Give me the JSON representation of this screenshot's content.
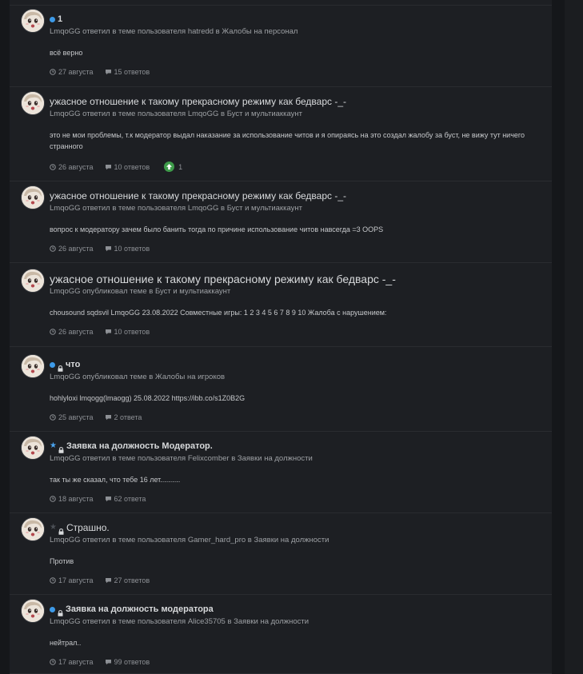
{
  "items": [
    {
      "dot": true,
      "lock": false,
      "star": null,
      "title": "1",
      "meta": "LmqoGG ответил в теме пользователя hatredd в Жалобы на персонал",
      "snippet": "всё верно",
      "date": "27 августа",
      "replies": "15 ответов"
    },
    {
      "dot": false,
      "lock": false,
      "star": null,
      "title": "ужасное отношение к такому прекрасному режиму как бедварс -_-",
      "meta": "LmqoGG ответил в теме пользователя LmqoGG в Буст и мультиаккаунт",
      "snippet": "это не мои проблемы, т.к модератор выдал наказание за использование читов и я опираясь на это создал жалобу за буст, не вижу тут ничего странного",
      "date": "26 августа",
      "replies": "10 ответов",
      "votes": "1"
    },
    {
      "dot": false,
      "lock": false,
      "star": null,
      "title": "ужасное отношение к такому прекрасному режиму как бедварс -_-",
      "meta": "LmqoGG ответил в теме пользователя LmqoGG в Буст и мультиаккаунт",
      "snippet": "вопрос к модератору зачем было банить тогда по причине использование читов навсегда =3 OOPS",
      "date": "26 августа",
      "replies": "10 ответов"
    },
    {
      "dot": false,
      "lock": false,
      "star": null,
      "title": "ужасное отношение к такому прекрасному режиму как бедварс -_-",
      "meta": "LmqoGG опубликовал теме в Буст и мультиаккаунт",
      "snippet": "chousound sqdsvil LmqoGG 23.08.2022 Совместные игры: 1 2 3 4 5 6 7 8 9 10 Жалоба с нарушением:",
      "date": "26 августа",
      "replies": "10 ответов"
    },
    {
      "dot": true,
      "lock": true,
      "star": null,
      "title": "что",
      "meta": "LmqoGG опубликовал теме в Жалобы на игроков",
      "snippet": "hohlyloxi lmqogg(lmaogg) 25.08.2022 https://ibb.co/s1Z0B2G",
      "date": "25 августа",
      "replies": "2 ответа"
    },
    {
      "dot": false,
      "lock": true,
      "star": "blue",
      "title": "Заявка на должность Модератор.",
      "meta": "LmqoGG ответил в теме пользователя Felixcomber в Заявки на должности",
      "snippet": "так ты же сказал, что тебе 16 лет..........",
      "date": "18 августа",
      "replies": "62 ответа"
    },
    {
      "dot": false,
      "lock": true,
      "star": "grey",
      "title": "Страшно.",
      "meta": "LmqoGG ответил в теме пользователя Gamer_hard_pro в Заявки на должности",
      "snippet": "Против",
      "date": "17 августа",
      "replies": "27 ответов"
    },
    {
      "dot": true,
      "lock": true,
      "star": null,
      "title": "Заявка на должность модератора",
      "meta": "LmqoGG ответил в теме пользователя Alice35705 в Заявки на должности",
      "snippet": "нейтрал..",
      "date": "17 августа",
      "replies": "99 ответов"
    }
  ],
  "colors": {
    "background": "#15171a",
    "panel": "#1d1f23",
    "unread_dot": "#3d9ae8",
    "upvote": "#3e9b4a"
  },
  "icons": {
    "date": "clock-icon",
    "replies": "comment-icon",
    "lock": "lock-icon",
    "star": "star-icon",
    "upvote": "upvote-arrow-icon"
  }
}
